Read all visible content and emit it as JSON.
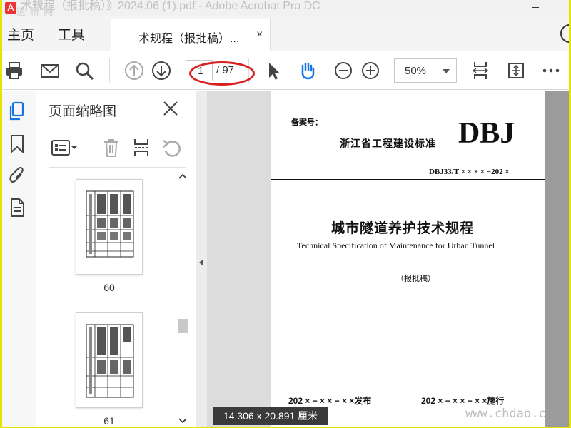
{
  "window": {
    "title": "术规程（报批稿）》2024.06 (1).pdf - Adobe Acrobat Pro DC",
    "watermark_top": "道 桥 网"
  },
  "tabs": {
    "home": "主页",
    "tools": "工具",
    "document": "术规程（报批稿）...",
    "close": "×"
  },
  "toolbar": {
    "current_page": "1",
    "total_pages": "/ 97",
    "zoom": "50%"
  },
  "thumbnail_panel": {
    "title": "页面缩略图",
    "pages": [
      {
        "label": "60"
      },
      {
        "label": "61"
      }
    ]
  },
  "document": {
    "filing_label": "备案号：",
    "standard_name": "浙江省工程建设标准",
    "logo": "DBJ",
    "standard_number": "DBJ33/T × × × × −202 ×",
    "title_zh": "城市隧道养护技术规程",
    "title_en": "Technical Specification of Maintenance for Urban Tunnel",
    "draft": "（报批稿）",
    "issue_date": "202 × − × × − × ×发布",
    "implement_date": "202 × − × × − × ×施行"
  },
  "status": {
    "page_dimensions": "14.306 x 20.891 厘米"
  },
  "watermark_bottom": "www.chdao.c",
  "colors": {
    "frame_yellow": "#e5e500",
    "annotation_red": "#d81e1e",
    "accent_blue": "#1473e6"
  }
}
